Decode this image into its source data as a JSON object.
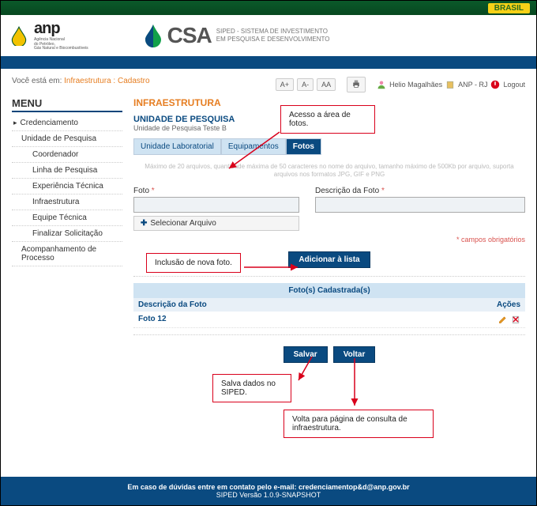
{
  "topbar": {
    "brasil": "BRASIL"
  },
  "header": {
    "anp_name": "anp",
    "anp_sub1": "Agência Nacional",
    "anp_sub2": "do Petróleo,",
    "anp_sub3": "Gás Natural e Biocombustíveis",
    "csa": "CSA",
    "csa_sub1": "SIPED - SISTEMA DE INVESTIMENTO",
    "csa_sub2": "EM PESQUISA E DESENVOLVIMENTO"
  },
  "breadcrumb": {
    "prefix": "Você está em:",
    "path1": "Infraestrutura",
    "sep": ":",
    "path2": "Cadastro"
  },
  "toolbar": {
    "a_plus": "A+",
    "a_minus": "A-",
    "aa": "AA",
    "user": "Helio Magalhães",
    "org": "ANP - RJ",
    "logout": "Logout"
  },
  "menu": {
    "title": "MENU",
    "items": [
      "Credenciamento",
      "Unidade de Pesquisa",
      "Coordenador",
      "Linha de Pesquisa",
      "Experiência Técnica",
      "Infraestrutura",
      "Equipe Técnica",
      "Finalizar Solicitação",
      "Acompanhamento de Processo"
    ]
  },
  "main": {
    "title": "INFRAESTRUTURA",
    "subtitle": "UNIDADE DE PESQUISA",
    "unit_name": "Unidade de Pesquisa Teste B",
    "tabs": {
      "t1": "Unidade Laboratorial",
      "t2": "Equipamentos",
      "t3": "Fotos"
    },
    "hint": "Máximo de 20 arquivos, quantidade máxima de 50 caracteres no nome do arquivo, tamanho máximo de 500Kb por arquivo, suporta arquivos nos formatos JPG, GIF e PNG",
    "foto_label": "Foto",
    "desc_label": "Descrição da Foto",
    "req": "*",
    "select_file": "Selecionar Arquivo",
    "required_note": "* campos obrigatórios",
    "add_list": "Adicionar à lista",
    "table_title": "Foto(s) Cadastrada(s)",
    "col_desc": "Descrição da Foto",
    "col_actions": "Ações",
    "rows": [
      {
        "desc": "Foto 12"
      }
    ],
    "save": "Salvar",
    "back": "Voltar"
  },
  "callouts": {
    "c1": "Acesso a área de fotos.",
    "c2": "Inclusão de nova foto.",
    "c3": "Salva dados no SIPED.",
    "c4": "Volta para página de consulta de infraestrutura."
  },
  "footer": {
    "line1a": "Em caso de dúvidas entre em contato pelo e-mail: ",
    "line1b": "credenciamentop&d@anp.gov.br",
    "line2": "SIPED Versão 1.0.9-SNAPSHOT"
  }
}
